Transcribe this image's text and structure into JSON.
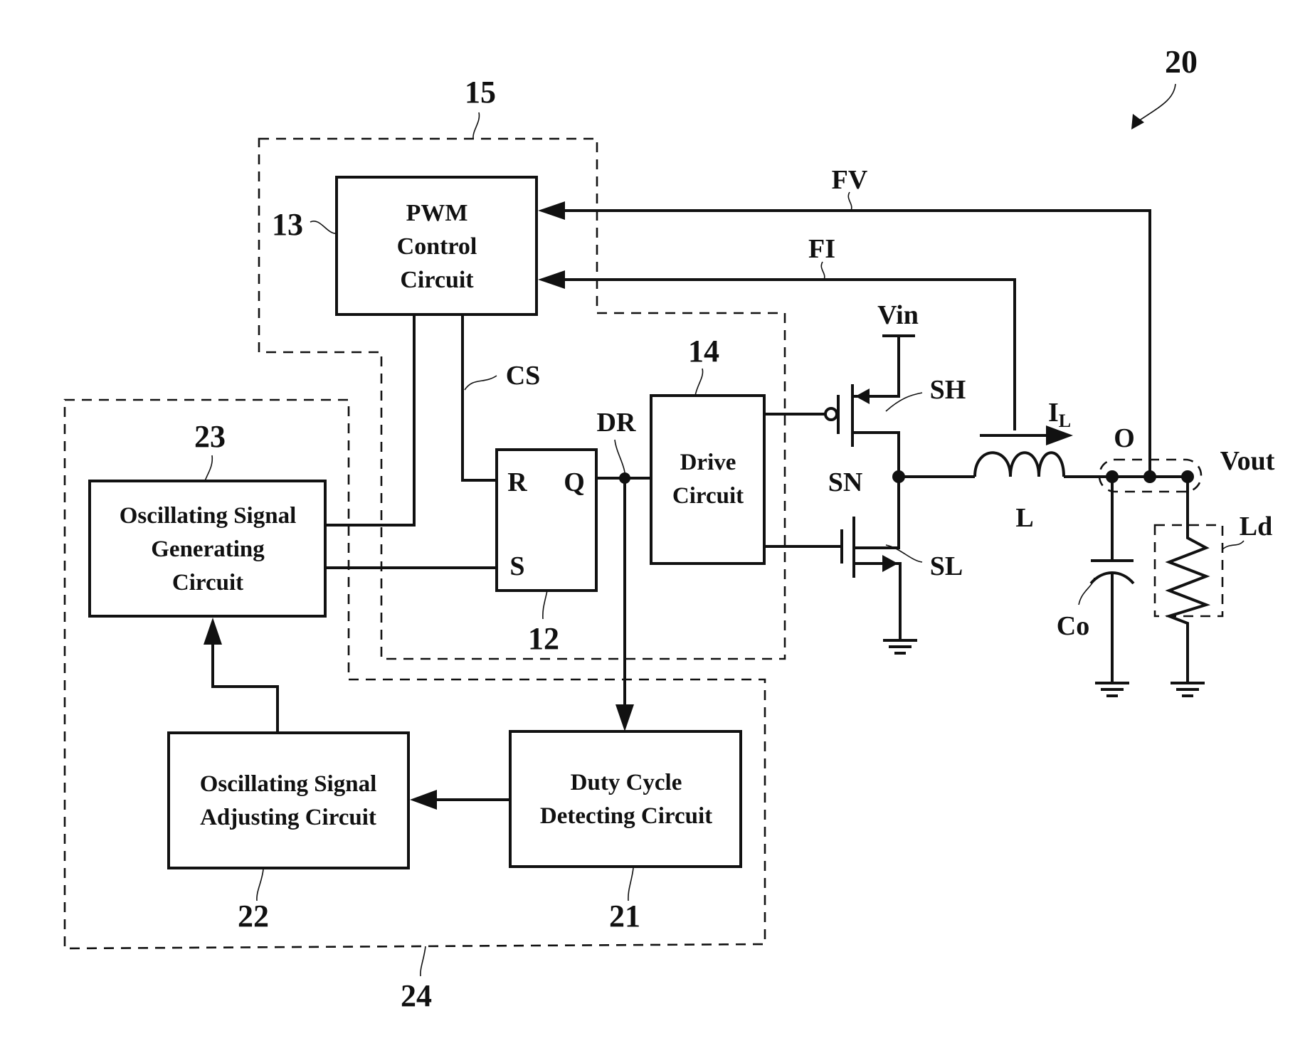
{
  "figure": {
    "ref_number": "20",
    "groups": {
      "pwm_group": {
        "ref": "15"
      },
      "drive_group": {
        "ref": ""
      },
      "adjust_group": {
        "ref": "24"
      }
    },
    "blocks": {
      "pwm_control": {
        "ref": "13",
        "lines": [
          "PWM",
          "Control",
          "Circuit"
        ]
      },
      "sr_latch": {
        "ref": "12",
        "pin_r": "R",
        "pin_s": "S",
        "pin_q": "Q"
      },
      "drive": {
        "ref": "14",
        "lines": [
          "Drive",
          "Circuit"
        ]
      },
      "osc_gen": {
        "ref": "23",
        "lines": [
          "Oscillating Signal",
          "Generating",
          "Circuit"
        ]
      },
      "osc_adjust": {
        "ref": "22",
        "lines": [
          "Oscillating Signal",
          "Adjusting Circuit"
        ]
      },
      "duty_detect": {
        "ref": "21",
        "lines": [
          "Duty Cycle",
          "Detecting Circuit"
        ]
      }
    },
    "signals": {
      "fv": "FV",
      "fi": "FI",
      "cs": "CS",
      "dr": "DR",
      "vin": "Vin",
      "sh": "SH",
      "sl": "SL",
      "sn": "SN",
      "il_main": "I",
      "il_sub": "L",
      "inductor": "L",
      "output_node": "O",
      "vout": "Vout",
      "cap": "Co",
      "load": "Ld"
    }
  }
}
